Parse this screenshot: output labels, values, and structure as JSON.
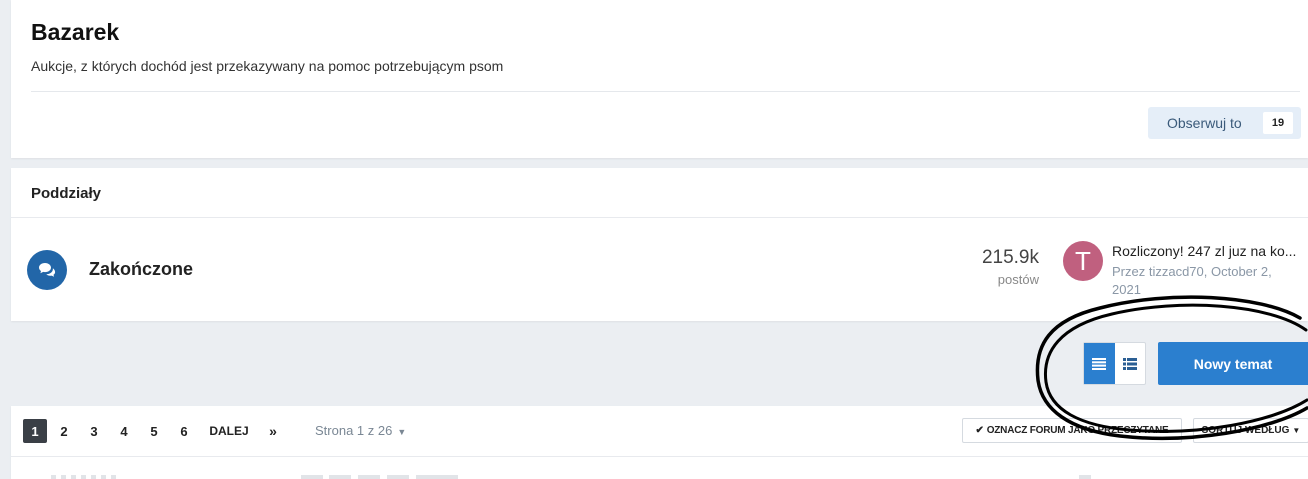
{
  "header": {
    "title": "Bazarek",
    "description": "Aukcje, z których dochód jest przekazywany na pomoc potrzebującym psom",
    "follow_label": "Obserwuj to",
    "follow_count": "19"
  },
  "subforums": {
    "heading": "Poddziały",
    "items": [
      {
        "title": "Zakończone",
        "icon": "comments-icon",
        "posts_count": "215.9k",
        "posts_label": "postów",
        "last_post": {
          "avatar_letter": "T",
          "avatar_color": "#c0607f",
          "title": "Rozliczony! 247 zl juz na ko...",
          "meta": "Przez tizzacd70, October 2, 2021"
        }
      }
    ]
  },
  "actions": {
    "view_table_icon": "list-table-icon",
    "view_grid_icon": "list-grid-icon",
    "new_topic_label": "Nowy temat"
  },
  "pagination": {
    "pages": [
      "1",
      "2",
      "3",
      "4",
      "5",
      "6"
    ],
    "current_page": "1",
    "next_label": "DALEJ",
    "last_label": "»",
    "page_indicator": "Strona 1 z 26",
    "mark_read_label": "OZNACZ FORUM JAKO PRZECZYTANE",
    "sort_label": "SORTUJ WEDŁUG"
  },
  "colors": {
    "accent": "#2b7fcf",
    "forum_icon": "#2266a8",
    "background": "#ebeef2"
  }
}
